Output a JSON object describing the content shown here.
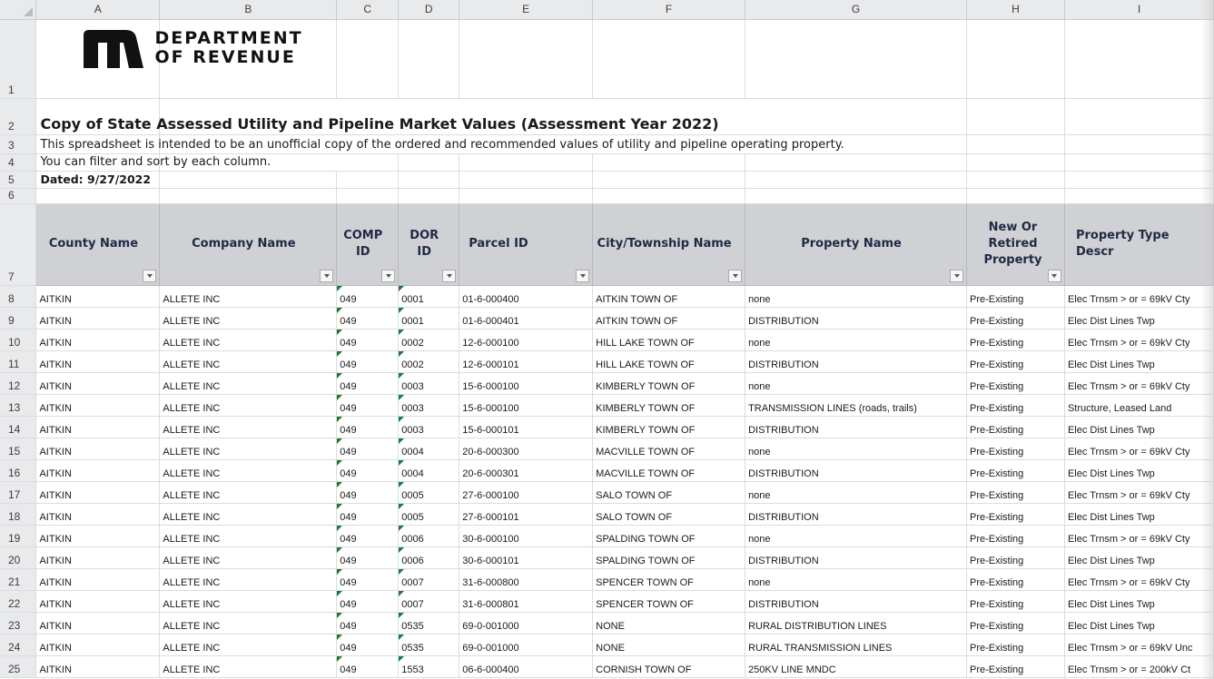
{
  "columns": [
    "A",
    "B",
    "C",
    "D",
    "E",
    "F",
    "G",
    "H",
    "I"
  ],
  "row_numbers": [
    "1",
    "2",
    "3",
    "4",
    "5",
    "6",
    "7"
  ],
  "logo": {
    "text_line1": "DEPARTMENT",
    "text_line2": "OF REVENUE",
    "mark": "mn-logo-icon"
  },
  "title": "Copy of State Assessed Utility and Pipeline Market Values (Assessment Year 2022)",
  "description": "This spreadsheet is intended to be an unofficial copy of the ordered and recommended values of utility and pipeline operating property.",
  "filter_note": "You can filter and sort by each column.",
  "dated": "Dated: 9/27/2022",
  "headers": [
    "County Name",
    "Company Name",
    "COMP ID",
    "DOR ID",
    "Parcel ID",
    "City/Township Name",
    "Property Name",
    "New Or Retired Property",
    "Property Type Descr"
  ],
  "rows": [
    {
      "n": "8",
      "cells": [
        "AITKIN",
        "ALLETE INC",
        "049",
        "0001",
        "01-6-000400",
        "AITKIN TOWN OF",
        "none",
        "Pre-Existing",
        "Elec Trnsm > or = 69kV Cty"
      ]
    },
    {
      "n": "9",
      "cells": [
        "AITKIN",
        "ALLETE INC",
        "049",
        "0001",
        "01-6-000401",
        "AITKIN TOWN OF",
        "DISTRIBUTION",
        "Pre-Existing",
        "Elec Dist Lines Twp"
      ]
    },
    {
      "n": "10",
      "cells": [
        "AITKIN",
        "ALLETE INC",
        "049",
        "0002",
        "12-6-000100",
        "HILL LAKE TOWN OF",
        "none",
        "Pre-Existing",
        "Elec Trnsm > or = 69kV Cty"
      ]
    },
    {
      "n": "11",
      "cells": [
        "AITKIN",
        "ALLETE INC",
        "049",
        "0002",
        "12-6-000101",
        "HILL LAKE TOWN OF",
        "DISTRIBUTION",
        "Pre-Existing",
        "Elec Dist Lines Twp"
      ]
    },
    {
      "n": "12",
      "cells": [
        "AITKIN",
        "ALLETE INC",
        "049",
        "0003",
        "15-6-000100",
        "KIMBERLY TOWN OF",
        "none",
        "Pre-Existing",
        "Elec Trnsm > or = 69kV Cty"
      ]
    },
    {
      "n": "13",
      "cells": [
        "AITKIN",
        "ALLETE INC",
        "049",
        "0003",
        "15-6-000100",
        "KIMBERLY TOWN OF",
        "TRANSMISSION LINES (roads, trails)",
        "Pre-Existing",
        "Structure, Leased Land"
      ]
    },
    {
      "n": "14",
      "cells": [
        "AITKIN",
        "ALLETE INC",
        "049",
        "0003",
        "15-6-000101",
        "KIMBERLY TOWN OF",
        "DISTRIBUTION",
        "Pre-Existing",
        "Elec Dist Lines Twp"
      ]
    },
    {
      "n": "15",
      "cells": [
        "AITKIN",
        "ALLETE INC",
        "049",
        "0004",
        "20-6-000300",
        "MACVILLE TOWN OF",
        "none",
        "Pre-Existing",
        "Elec Trnsm > or = 69kV Cty"
      ]
    },
    {
      "n": "16",
      "cells": [
        "AITKIN",
        "ALLETE INC",
        "049",
        "0004",
        "20-6-000301",
        "MACVILLE TOWN OF",
        "DISTRIBUTION",
        "Pre-Existing",
        "Elec Dist Lines Twp"
      ]
    },
    {
      "n": "17",
      "cells": [
        "AITKIN",
        "ALLETE INC",
        "049",
        "0005",
        "27-6-000100",
        "SALO TOWN OF",
        "none",
        "Pre-Existing",
        "Elec Trnsm > or = 69kV Cty"
      ]
    },
    {
      "n": "18",
      "cells": [
        "AITKIN",
        "ALLETE INC",
        "049",
        "0005",
        "27-6-000101",
        "SALO TOWN OF",
        "DISTRIBUTION",
        "Pre-Existing",
        "Elec Dist Lines Twp"
      ]
    },
    {
      "n": "19",
      "cells": [
        "AITKIN",
        "ALLETE INC",
        "049",
        "0006",
        "30-6-000100",
        "SPALDING TOWN OF",
        "none",
        "Pre-Existing",
        "Elec Trnsm > or = 69kV Cty"
      ]
    },
    {
      "n": "20",
      "cells": [
        "AITKIN",
        "ALLETE INC",
        "049",
        "0006",
        "30-6-000101",
        "SPALDING TOWN OF",
        "DISTRIBUTION",
        "Pre-Existing",
        "Elec Dist Lines Twp"
      ]
    },
    {
      "n": "21",
      "cells": [
        "AITKIN",
        "ALLETE INC",
        "049",
        "0007",
        "31-6-000800",
        "SPENCER TOWN OF",
        "none",
        "Pre-Existing",
        "Elec Trnsm > or = 69kV Cty"
      ]
    },
    {
      "n": "22",
      "cells": [
        "AITKIN",
        "ALLETE INC",
        "049",
        "0007",
        "31-6-000801",
        "SPENCER TOWN OF",
        "DISTRIBUTION",
        "Pre-Existing",
        "Elec Dist Lines Twp"
      ]
    },
    {
      "n": "23",
      "cells": [
        "AITKIN",
        "ALLETE INC",
        "049",
        "0535",
        "69-0-001000",
        "NONE",
        "RURAL DISTRIBUTION LINES",
        "Pre-Existing",
        "Elec Dist Lines Twp"
      ]
    },
    {
      "n": "24",
      "cells": [
        "AITKIN",
        "ALLETE INC",
        "049",
        "0535",
        "69-0-001000",
        "NONE",
        "RURAL TRANSMISSION LINES",
        "Pre-Existing",
        "Elec Trnsm > or = 69kV Unc"
      ]
    },
    {
      "n": "25",
      "cells": [
        "AITKIN",
        "ALLETE INC",
        "049",
        "1553",
        "06-6-000400",
        "CORNISH TOWN OF",
        "250KV LINE MNDC",
        "Pre-Existing",
        "Elec Trnsm > or = 200kV Ct"
      ]
    }
  ],
  "colors": {
    "header_fill": "#cfd1d4",
    "header_text": "#1f2a44",
    "chrome": "#e9eaec",
    "gridline": "#dadcdf",
    "error_marker": "#1e7b34"
  }
}
